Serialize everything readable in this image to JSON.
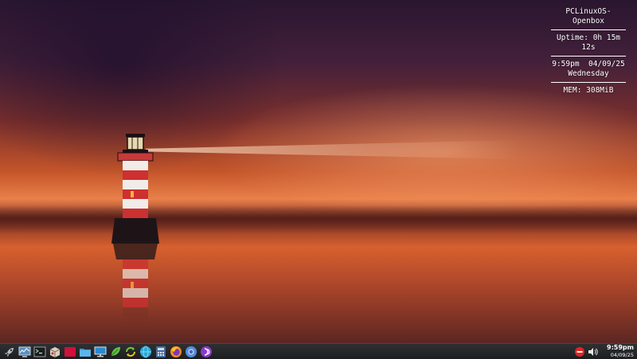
{
  "conky": {
    "hostname": "PCLinuxOS-Openbox",
    "uptime": "Uptime: 0h 15m 12s",
    "datetime": "9:59pm  04/09/25",
    "weekday": "Wednesday",
    "memory": "MEM: 308MiB"
  },
  "taskbar": {
    "launchers": [
      {
        "name": "rocket-icon"
      },
      {
        "name": "system-monitor-icon"
      },
      {
        "name": "terminal-icon"
      },
      {
        "name": "package-manager-icon"
      },
      {
        "name": "red-square-app-icon"
      },
      {
        "name": "file-manager-icon"
      },
      {
        "name": "display-settings-icon"
      },
      {
        "name": "green-leaf-icon"
      },
      {
        "name": "refresh-arrows-icon"
      },
      {
        "name": "blue-globe-icon"
      },
      {
        "name": "calculator-icon"
      },
      {
        "name": "firefox-icon"
      },
      {
        "name": "chromium-icon"
      },
      {
        "name": "purple-app-icon"
      }
    ],
    "tray": {
      "notification_icon": "stop-icon",
      "volume_icon": "speaker-icon"
    },
    "clock": {
      "time": "9:59pm",
      "date": "04/09/25"
    }
  },
  "colors": {
    "taskbar": "#232427",
    "conky_text": "#ffffff"
  }
}
